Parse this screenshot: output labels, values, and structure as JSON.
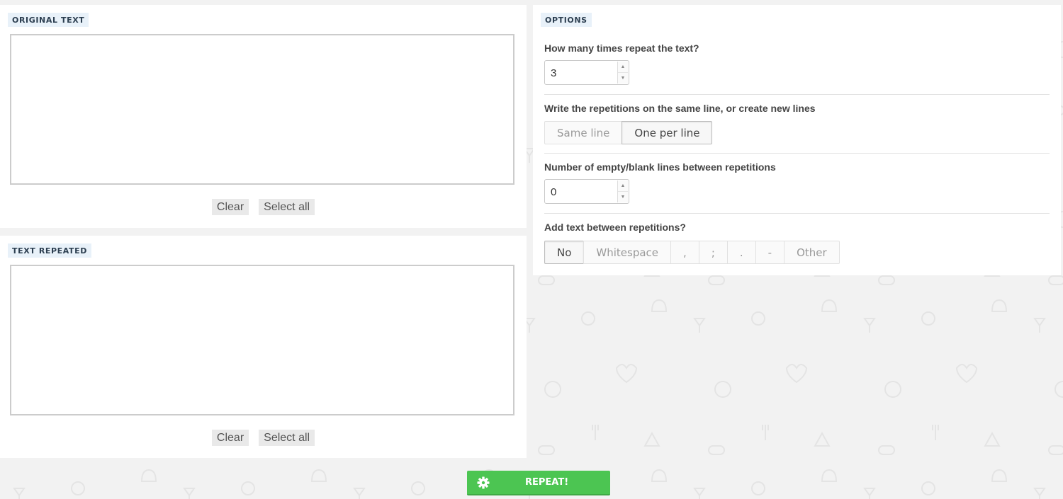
{
  "original_panel": {
    "label": "ORIGINAL TEXT",
    "textarea_value": "",
    "clear_label": "Clear",
    "select_all_label": "Select all"
  },
  "repeated_panel": {
    "label": "TEXT REPEATED",
    "textarea_value": "",
    "clear_label": "Clear",
    "select_all_label": "Select all"
  },
  "options": {
    "label": "OPTIONS",
    "repeat_count": {
      "question": "How many times repeat the text?",
      "value": "3"
    },
    "line_mode": {
      "question": "Write the repetitions on the same line, or create new lines",
      "choices": [
        "Same line",
        "One per line"
      ],
      "selected": "One per line"
    },
    "blank_lines": {
      "question": "Number of empty/blank lines between repetitions",
      "value": "0"
    },
    "separator": {
      "question": "Add text between repetitions?",
      "choices": [
        "No",
        "Whitespace",
        ",",
        ";",
        ".",
        "-",
        "Other"
      ],
      "selected": "No"
    }
  },
  "repeat_button": {
    "label": "REPEAT!",
    "icon": "gear-icon",
    "color": "#4cc552"
  },
  "colors": {
    "background": "#f2f2f2",
    "label_bg": "#e8f1f9"
  }
}
